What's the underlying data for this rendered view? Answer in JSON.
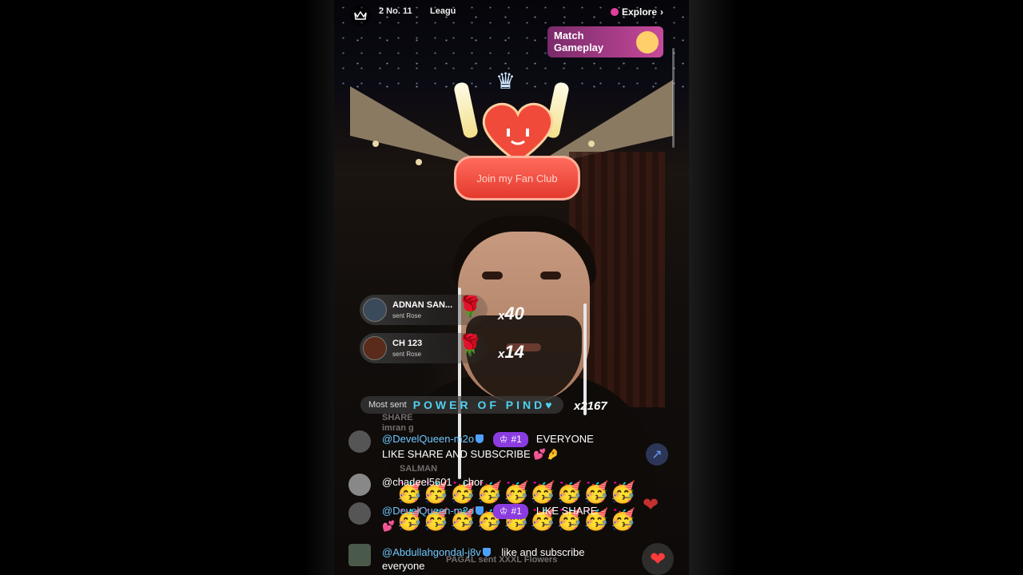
{
  "topbar": {
    "league_rank": "2 No. 11",
    "league_label": "Leagu",
    "explore_label": "Explore",
    "explore_arrow": "›",
    "match_gameplay": "Match Gameplay"
  },
  "sticker": {
    "fan_club_text": "Join my Fan Club"
  },
  "gifts": [
    {
      "name": "ADNAN SAN...",
      "action": "sent Rose",
      "multiplier": "x",
      "count": "40",
      "icon": "rose-icon"
    },
    {
      "name": "CH 123",
      "action": "sent Rose",
      "multiplier": "x",
      "count": "14",
      "icon": "rose-icon"
    }
  ],
  "most_sent": {
    "label": "Most sent",
    "name": "POWER OF PIND♥",
    "count": "x2167"
  },
  "chat": {
    "ghost_lines": [
      "SHARE",
      "imran g",
      "SALMAN",
      "PAGAL sent XXXL Flowers"
    ],
    "messages": [
      {
        "user": "@DevelQueen-m2o",
        "rank": "#1",
        "text_inline": "EVERYONE",
        "text": "LIKE SHARE AND SUBSCRIBE 💕🤌"
      },
      {
        "user": "@chadeel5601",
        "rank": "",
        "text_inline": "chor",
        "text": ""
      },
      {
        "user": "@DevelQueen-m2o",
        "rank": "#1",
        "text_inline": "LIKE SHARE",
        "text": "💕"
      },
      {
        "user": "@Abdullahgondal-j8v",
        "rank": "",
        "text_inline": "like and subscribe",
        "text": "everyone"
      }
    ],
    "emoji_line_1": "🥳🥳🥳🥳🥳🥳🥳🥳🥳",
    "emoji_line_2": "🥳🥳🥳🥳🥳🥳🥳🥳🥳"
  },
  "actions": {
    "share_icon": "↗",
    "heart_icon": "❤"
  }
}
